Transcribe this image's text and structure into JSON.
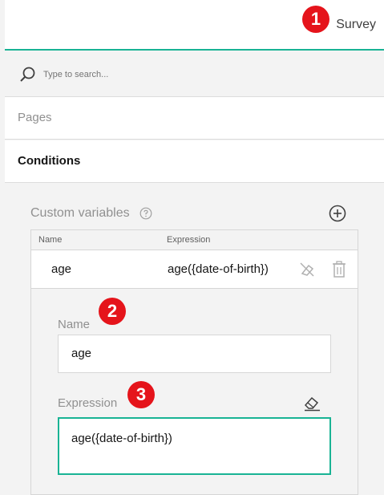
{
  "header": {
    "tab_label": "Survey"
  },
  "search": {
    "placeholder": "Type to search..."
  },
  "sections": {
    "pages": "Pages",
    "conditions": "Conditions"
  },
  "custom_variables": {
    "title": "Custom variables",
    "columns": {
      "name": "Name",
      "expression": "Expression"
    },
    "rows": [
      {
        "name": "age",
        "expression": "age({date-of-birth})"
      }
    ]
  },
  "editor": {
    "name_label": "Name",
    "name_value": "age",
    "expression_label": "Expression",
    "expression_value": "age({date-of-birth})"
  },
  "badges": [
    "1",
    "2",
    "3"
  ],
  "colors": {
    "accent": "#19b394",
    "badge": "#e5141b",
    "text": "#161616",
    "muted": "#909090"
  },
  "icons": [
    "search-icon",
    "help-icon",
    "add-icon",
    "clear-icon",
    "trash-icon",
    "eraser-icon"
  ]
}
